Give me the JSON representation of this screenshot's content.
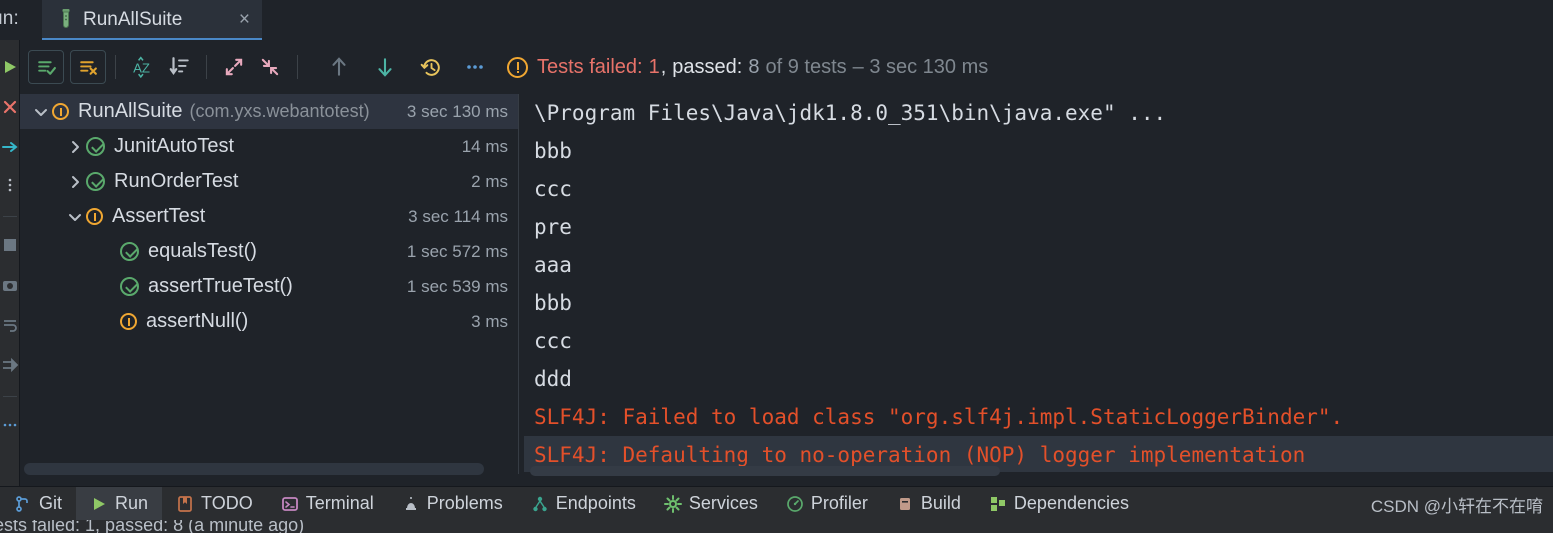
{
  "window": {
    "run_label": "un:",
    "tab": {
      "title": "RunAllSuite",
      "close": "×",
      "icon": "test-tube-icon"
    }
  },
  "toolbar": {
    "buttons": [
      {
        "name": "show-passed-toggle",
        "icon": "list-check-icon",
        "color": "#5aa96c"
      },
      {
        "name": "hide-passed-toggle",
        "icon": "list-x-icon",
        "color": "#e0a32e"
      },
      {
        "name": "sort-alphabetically-button",
        "icon": "sort-az-icon",
        "color": "#4cb3a4"
      },
      {
        "name": "sort-by-duration-button",
        "icon": "sort-duration-icon",
        "color": "#b9bfc7"
      },
      {
        "name": "expand-all-button",
        "icon": "expand-arrows-icon",
        "color": "#e8a9bd"
      },
      {
        "name": "collapse-all-button",
        "icon": "collapse-arrows-icon",
        "color": "#e8a9bd"
      },
      {
        "name": "previous-failed-test-button",
        "icon": "arrow-up-icon",
        "color": "#6b7782"
      },
      {
        "name": "next-failed-test-button",
        "icon": "arrow-down-icon",
        "color": "#4cb3a4"
      },
      {
        "name": "test-history-button",
        "icon": "history-clock-icon",
        "color": "#e8c45c"
      },
      {
        "name": "more-options-button",
        "icon": "ellipsis-icon",
        "color": "#5b9bd5"
      }
    ],
    "status": {
      "icon": "warning-circle-icon",
      "failed_label": "Tests failed:",
      "failed_count": "1",
      "comma": ",",
      "passed_label": "passed:",
      "passed_count": "8",
      "of_tests": "of 9 tests",
      "dash_duration": "– 3 sec 130 ms"
    }
  },
  "tree": {
    "rows": [
      {
        "indent": 0,
        "chevron": "down",
        "status": "warning",
        "name": "RunAllSuite",
        "package": "(com.yxs.webantotest)",
        "time": "3 sec 130 ms",
        "selected": true
      },
      {
        "indent": 1,
        "chevron": "right",
        "status": "passed",
        "name": "JunitAutoTest",
        "package": "",
        "time": "14 ms",
        "selected": false
      },
      {
        "indent": 1,
        "chevron": "right",
        "status": "passed",
        "name": "RunOrderTest",
        "package": "",
        "time": "2 ms",
        "selected": false
      },
      {
        "indent": 1,
        "chevron": "down",
        "status": "warning",
        "name": "AssertTest",
        "package": "",
        "time": "3 sec 114 ms",
        "selected": false
      },
      {
        "indent": 2,
        "chevron": "none",
        "status": "passed",
        "name": "equalsTest()",
        "package": "",
        "time": "1 sec 572 ms",
        "selected": false
      },
      {
        "indent": 2,
        "chevron": "none",
        "status": "passed",
        "name": "assertTrueTest()",
        "package": "",
        "time": "1 sec 539 ms",
        "selected": false
      },
      {
        "indent": 2,
        "chevron": "none",
        "status": "warning",
        "name": "assertNull()",
        "package": "",
        "time": "3 ms",
        "selected": false
      }
    ]
  },
  "console": {
    "lines": [
      {
        "text": "\\Program Files\\Java\\jdk1.8.0_351\\bin\\java.exe\" ...",
        "type": "normal",
        "selected": false
      },
      {
        "text": "bbb",
        "type": "normal",
        "selected": false
      },
      {
        "text": "ccc",
        "type": "normal",
        "selected": false
      },
      {
        "text": "pre",
        "type": "normal",
        "selected": false
      },
      {
        "text": "aaa",
        "type": "normal",
        "selected": false
      },
      {
        "text": "bbb",
        "type": "normal",
        "selected": false
      },
      {
        "text": "ccc",
        "type": "normal",
        "selected": false
      },
      {
        "text": "ddd",
        "type": "normal",
        "selected": false
      },
      {
        "text": "SLF4J: Failed to load class \"org.slf4j.impl.StaticLoggerBinder\".",
        "type": "error",
        "selected": false
      },
      {
        "text": "SLF4J: Defaulting to no-operation (NOP) logger implementation",
        "type": "error",
        "selected": true
      }
    ]
  },
  "bottom_bar": {
    "items": [
      {
        "label": "Git",
        "icon": "git-branch-icon",
        "color": "#5b9bd5",
        "active": false
      },
      {
        "label": "Run",
        "icon": "play-triangle-icon",
        "color": "#8fc866",
        "active": true
      },
      {
        "label": "TODO",
        "icon": "todo-bookmark-icon",
        "color": "#c5734b",
        "active": false
      },
      {
        "label": "Terminal",
        "icon": "terminal-prompt-icon",
        "color": "#c586c0",
        "active": false
      },
      {
        "label": "Problems",
        "icon": "alarm-lamp-icon",
        "color": "#b9bfc7",
        "active": false
      },
      {
        "label": "Endpoints",
        "icon": "endpoints-node-icon",
        "color": "#3aa48e",
        "active": false
      },
      {
        "label": "Services",
        "icon": "gear-icon",
        "color": "#6fc06f",
        "active": false
      },
      {
        "label": "Profiler",
        "icon": "profiler-gauge-icon",
        "color": "#5aa96c",
        "active": false
      },
      {
        "label": "Build",
        "icon": "build-hammer-icon",
        "color": "#c09a8a",
        "active": false
      },
      {
        "label": "Dependencies",
        "icon": "dependencies-blocks-icon",
        "color": "#8fc866",
        "active": false
      }
    ]
  },
  "watermark": {
    "text": "CSDN @小轩在不在唷"
  },
  "status_line": {
    "text": "ests failed: 1, passed: 8 (a minute ago)"
  },
  "colors": {
    "background": "#1f2329",
    "panel": "#2b2d30",
    "selection": "#2e3440",
    "accent_blue": "#4a88c7",
    "error_red": "#e3502a",
    "failed_text": "#e8736a",
    "warning_orange": "#f0a732",
    "success_green": "#5aa96c",
    "text_primary": "#d6dbe2",
    "text_dim": "#9aa3ad"
  }
}
